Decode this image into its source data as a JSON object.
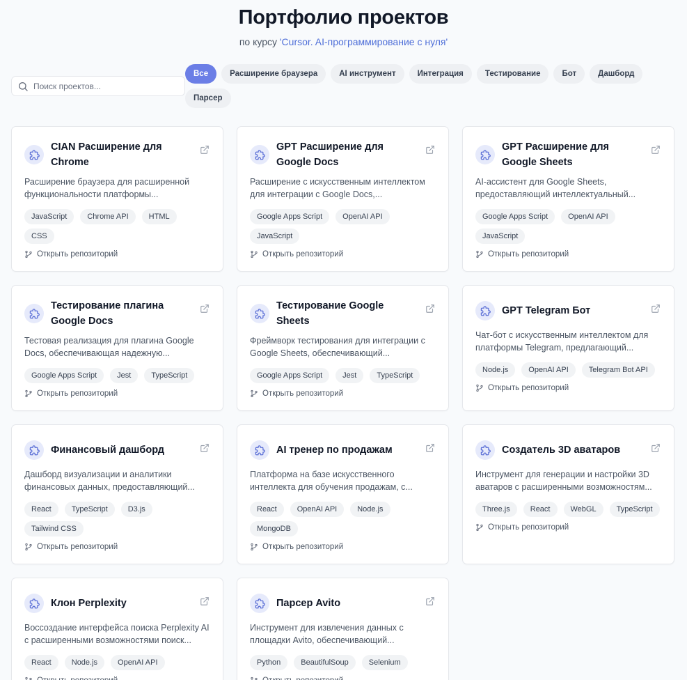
{
  "header": {
    "title": "Портфолио проектов",
    "subtitle_prefix": "по курсу ",
    "course": "'Cursor. AI-программирование с нуля'"
  },
  "search": {
    "placeholder": "Поиск проектов..."
  },
  "filters": [
    "Все",
    "Расширение браузера",
    "AI инструмент",
    "Интеграция",
    "Тестирование",
    "Бот",
    "Дашборд",
    "Парсер"
  ],
  "active_filter": "Все",
  "repo_label": "Открыть репозиторий",
  "colors": {
    "accent": "#6b7ee6",
    "icon_bg": "#e6eafb"
  },
  "projects": [
    {
      "title": "CIAN Расширение для Chrome",
      "desc": "Расширение браузера для расширенной функциональности платформы...",
      "tags": [
        "JavaScript",
        "Chrome API",
        "HTML",
        "CSS"
      ]
    },
    {
      "title": "GPT Расширение для Google Docs",
      "desc": "Расширение с искусственным интеллектом для интеграции с Google Docs,...",
      "tags": [
        "Google Apps Script",
        "OpenAI API",
        "JavaScript"
      ]
    },
    {
      "title": "GPT Расширение для Google Sheets",
      "desc": "AI-ассистент для Google Sheets, предоставляющий интеллектуальный...",
      "tags": [
        "Google Apps Script",
        "OpenAI API",
        "JavaScript"
      ]
    },
    {
      "title": "Тестирование плагина Google Docs",
      "desc": "Тестовая реализация для плагина Google Docs, обеспечивающая надежную...",
      "tags": [
        "Google Apps Script",
        "Jest",
        "TypeScript"
      ]
    },
    {
      "title": "Тестирование Google Sheets",
      "desc": "Фреймворк тестирования для интеграции с Google Sheets, обеспечивающий...",
      "tags": [
        "Google Apps Script",
        "Jest",
        "TypeScript"
      ]
    },
    {
      "title": "GPT Telegram Бот",
      "desc": "Чат-бот с искусственным интеллектом для платформы Telegram, предлагающий...",
      "tags": [
        "Node.js",
        "OpenAI API",
        "Telegram Bot API"
      ]
    },
    {
      "title": "Финансовый дашборд",
      "desc": "Дашборд визуализации и аналитики финансовых данных, предоставляющий...",
      "tags": [
        "React",
        "TypeScript",
        "D3.js",
        "Tailwind CSS"
      ]
    },
    {
      "title": "AI тренер по продажам",
      "desc": "Платформа на базе искусственного интеллекта для обучения продажам, с...",
      "tags": [
        "React",
        "OpenAI API",
        "Node.js",
        "MongoDB"
      ]
    },
    {
      "title": "Создатель 3D аватаров",
      "desc": "Инструмент для генерации и настройки 3D аватаров с расширенными возможностям...",
      "tags": [
        "Three.js",
        "React",
        "WebGL",
        "TypeScript"
      ]
    },
    {
      "title": "Клон Perplexity",
      "desc": "Воссоздание интерфейса поиска Perplexity AI с расширенными возможностями поиск...",
      "tags": [
        "React",
        "Node.js",
        "OpenAI API"
      ]
    },
    {
      "title": "Парсер Avito",
      "desc": "Инструмент для извлечения данных с площадки Avito, обеспечивающий...",
      "tags": [
        "Python",
        "BeautifulSoup",
        "Selenium"
      ]
    }
  ]
}
